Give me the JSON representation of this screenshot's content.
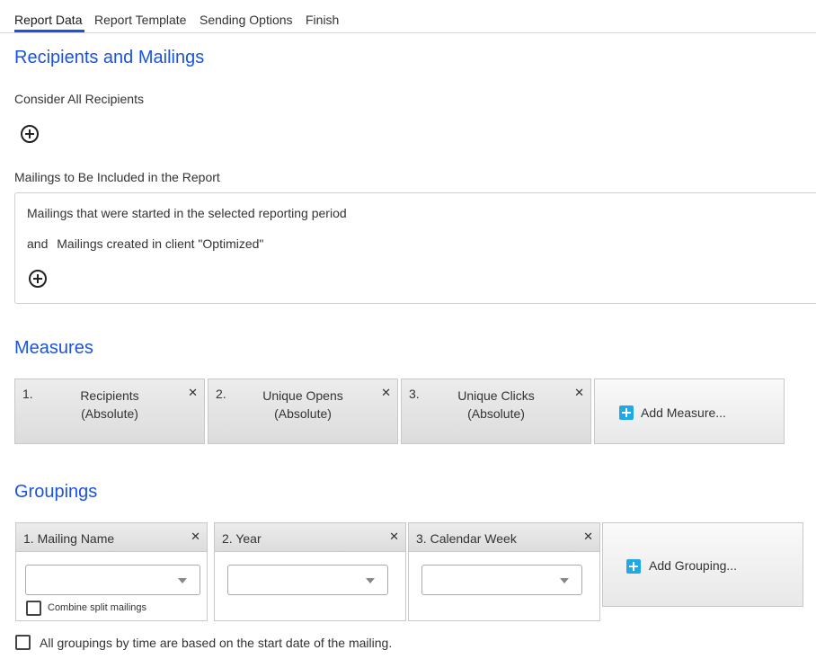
{
  "tabs": [
    {
      "label": "Report Data"
    },
    {
      "label": "Report Template"
    },
    {
      "label": "Sending Options"
    },
    {
      "label": "Finish"
    }
  ],
  "active_tab": "Report Data",
  "accent_color": "#1a53e0",
  "recipients_section": {
    "title": "Recipients and Mailings",
    "consider_label": "Consider All Recipients",
    "mailings_label": "Mailings to Be Included in the Report",
    "mailing_conditions": [
      {
        "prefix": "",
        "text": "Mailings that were started in the selected reporting period"
      },
      {
        "prefix": "and",
        "text": "Mailings created in client \"Optimized\""
      }
    ]
  },
  "measures_section": {
    "title": "Measures",
    "items": [
      {
        "number": "1.",
        "name": "Recipients",
        "mode": "(Absolute)"
      },
      {
        "number": "2.",
        "name": "Unique Opens",
        "mode": "(Absolute)"
      },
      {
        "number": "3.",
        "name": "Unique Clicks",
        "mode": "(Absolute)"
      }
    ],
    "add_label": "Add Measure..."
  },
  "groupings_section": {
    "title": "Groupings",
    "items": [
      {
        "number": "1.",
        "name": "Mailing Name",
        "selected": "",
        "option_label": "Combine split mailings"
      },
      {
        "number": "2.",
        "name": "Year",
        "selected": ""
      },
      {
        "number": "3.",
        "name": "Calendar Week",
        "selected": ""
      }
    ],
    "add_label": "Add Grouping...",
    "time_note": "All groupings by time are based on the start date of the mailing."
  },
  "icons": {
    "close": "close-icon",
    "add_condition": "plus-circle-icon",
    "add_item": "plus-square-icon",
    "dropdown": "chevron-down-icon"
  }
}
